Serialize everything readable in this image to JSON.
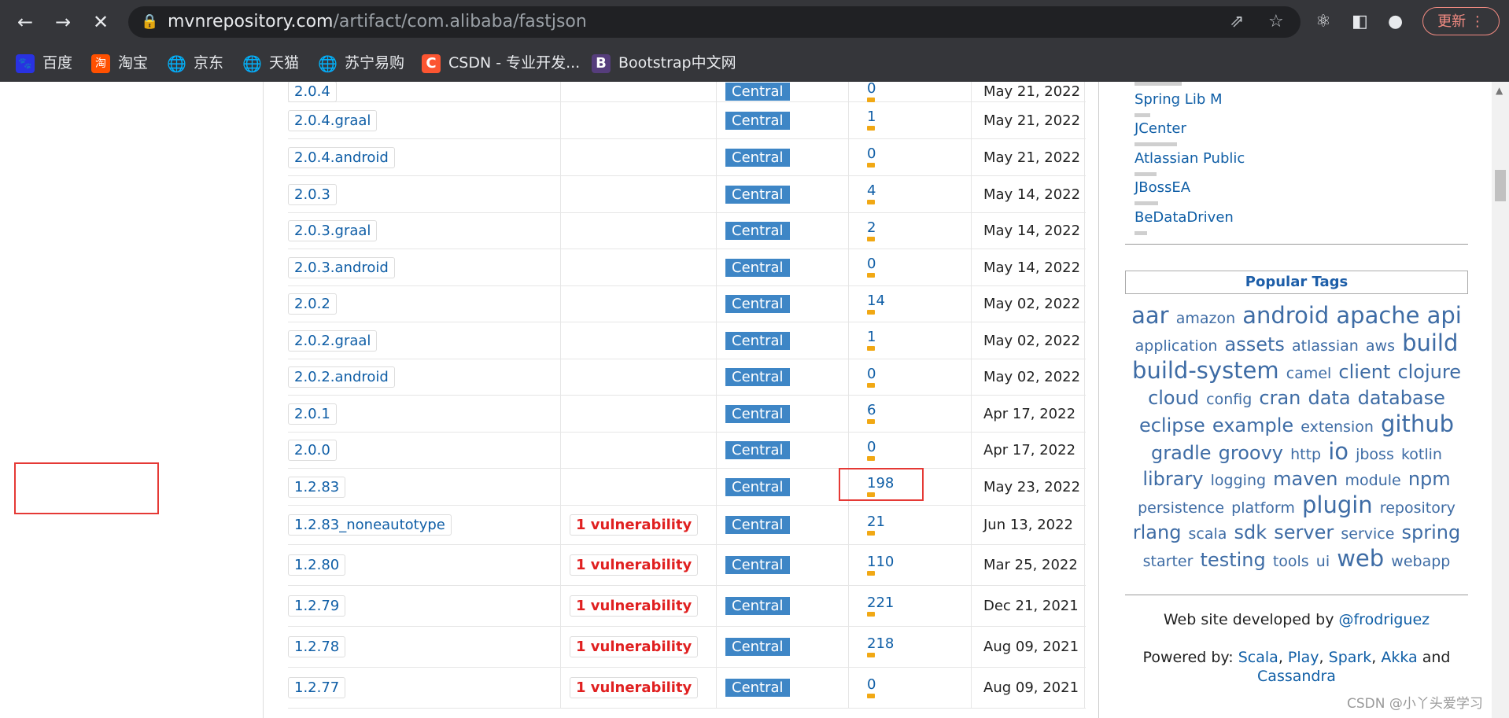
{
  "browser": {
    "url_host": "mvnrepository.com",
    "url_path": "/artifact/com.alibaba/fastjson",
    "update_label": "更新"
  },
  "bookmarks": [
    {
      "label": "百度",
      "icon": "baidu-icon",
      "color": "#2932e1"
    },
    {
      "label": "淘宝",
      "icon": "taobao-icon",
      "color": "#ff5000"
    },
    {
      "label": "京东",
      "icon": "globe-icon",
      "color": "#888888"
    },
    {
      "label": "天猫",
      "icon": "globe-icon",
      "color": "#888888"
    },
    {
      "label": "苏宁易购",
      "icon": "globe-icon",
      "color": "#888888"
    },
    {
      "label": "CSDN - 专业开发...",
      "icon": "csdn-icon",
      "color": "#fc5531"
    },
    {
      "label": "Bootstrap中文网",
      "icon": "bootstrap-icon",
      "color": "#563d7c"
    }
  ],
  "versions": [
    {
      "version": "2.0.4",
      "vuln": "",
      "repo": "Central",
      "usages": "0",
      "date": "May 21, 2022"
    },
    {
      "version": "2.0.4.graal",
      "vuln": "",
      "repo": "Central",
      "usages": "1",
      "date": "May 21, 2022"
    },
    {
      "version": "2.0.4.android",
      "vuln": "",
      "repo": "Central",
      "usages": "0",
      "date": "May 21, 2022"
    },
    {
      "version": "2.0.3",
      "vuln": "",
      "repo": "Central",
      "usages": "4",
      "date": "May 14, 2022"
    },
    {
      "version": "2.0.3.graal",
      "vuln": "",
      "repo": "Central",
      "usages": "2",
      "date": "May 14, 2022"
    },
    {
      "version": "2.0.3.android",
      "vuln": "",
      "repo": "Central",
      "usages": "0",
      "date": "May 14, 2022"
    },
    {
      "version": "2.0.2",
      "vuln": "",
      "repo": "Central",
      "usages": "14",
      "date": "May 02, 2022"
    },
    {
      "version": "2.0.2.graal",
      "vuln": "",
      "repo": "Central",
      "usages": "1",
      "date": "May 02, 2022"
    },
    {
      "version": "2.0.2.android",
      "vuln": "",
      "repo": "Central",
      "usages": "0",
      "date": "May 02, 2022"
    },
    {
      "version": "2.0.1",
      "vuln": "",
      "repo": "Central",
      "usages": "6",
      "date": "Apr 17, 2022"
    },
    {
      "version": "2.0.0",
      "vuln": "",
      "repo": "Central",
      "usages": "0",
      "date": "Apr 17, 2022"
    },
    {
      "version": "1.2.83",
      "vuln": "",
      "repo": "Central",
      "usages": "198",
      "date": "May 23, 2022"
    },
    {
      "version": "1.2.83_noneautotype",
      "vuln": "1 vulnerability",
      "repo": "Central",
      "usages": "21",
      "date": "Jun 13, 2022"
    },
    {
      "version": "1.2.80",
      "vuln": "1 vulnerability",
      "repo": "Central",
      "usages": "110",
      "date": "Mar 25, 2022"
    },
    {
      "version": "1.2.79",
      "vuln": "1 vulnerability",
      "repo": "Central",
      "usages": "221",
      "date": "Dec 21, 2021"
    },
    {
      "version": "1.2.78",
      "vuln": "1 vulnerability",
      "repo": "Central",
      "usages": "218",
      "date": "Aug 09, 2021"
    },
    {
      "version": "1.2.77",
      "vuln": "1 vulnerability",
      "repo": "Central",
      "usages": "0",
      "date": "Aug 09, 2021"
    }
  ],
  "sidebar": {
    "repositories": [
      "Spring Lib M",
      "JCenter",
      "Atlassian Public",
      "JBossEA",
      "BeDataDriven"
    ],
    "popular_tags_title": "Popular Tags",
    "tags": [
      {
        "t": "aar",
        "s": 3
      },
      {
        "t": "amazon",
        "s": 1
      },
      {
        "t": "android",
        "s": 3
      },
      {
        "t": "apache",
        "s": 3
      },
      {
        "t": "api",
        "s": 3
      },
      {
        "t": "application",
        "s": 1
      },
      {
        "t": "assets",
        "s": 2
      },
      {
        "t": "atlassian",
        "s": 1
      },
      {
        "t": "aws",
        "s": 1
      },
      {
        "t": "build",
        "s": 3
      },
      {
        "t": "build-system",
        "s": 3
      },
      {
        "t": "camel",
        "s": 1
      },
      {
        "t": "client",
        "s": 2
      },
      {
        "t": "clojure",
        "s": 2
      },
      {
        "t": "cloud",
        "s": 2
      },
      {
        "t": "config",
        "s": 1
      },
      {
        "t": "cran",
        "s": 2
      },
      {
        "t": "data",
        "s": 2
      },
      {
        "t": "database",
        "s": 2
      },
      {
        "t": "eclipse",
        "s": 2
      },
      {
        "t": "example",
        "s": 2
      },
      {
        "t": "extension",
        "s": 1
      },
      {
        "t": "github",
        "s": 3
      },
      {
        "t": "gradle",
        "s": 2
      },
      {
        "t": "groovy",
        "s": 2
      },
      {
        "t": "http",
        "s": 1
      },
      {
        "t": "io",
        "s": 3
      },
      {
        "t": "jboss",
        "s": 1
      },
      {
        "t": "kotlin",
        "s": 1
      },
      {
        "t": "library",
        "s": 2
      },
      {
        "t": "logging",
        "s": 1
      },
      {
        "t": "maven",
        "s": 2
      },
      {
        "t": "module",
        "s": 1
      },
      {
        "t": "npm",
        "s": 2
      },
      {
        "t": "persistence",
        "s": 1
      },
      {
        "t": "platform",
        "s": 1
      },
      {
        "t": "plugin",
        "s": 3
      },
      {
        "t": "repository",
        "s": 1
      },
      {
        "t": "rlang",
        "s": 2
      },
      {
        "t": "scala",
        "s": 1
      },
      {
        "t": "sdk",
        "s": 2
      },
      {
        "t": "server",
        "s": 2
      },
      {
        "t": "service",
        "s": 1
      },
      {
        "t": "spring",
        "s": 2
      },
      {
        "t": "starter",
        "s": 1
      },
      {
        "t": "testing",
        "s": 2
      },
      {
        "t": "tools",
        "s": 1
      },
      {
        "t": "ui",
        "s": 1
      },
      {
        "t": "web",
        "s": 3
      },
      {
        "t": "webapp",
        "s": 1
      }
    ],
    "developed_by_prefix": "Web site developed by",
    "developer": "@frodriguez",
    "powered_by_prefix": "Powered by:",
    "powered": [
      "Scala",
      "Play",
      "Spark",
      "Akka"
    ],
    "powered_and": "and",
    "powered_last": "Cassandra"
  },
  "watermark": "CSDN @小丫头爱学习"
}
